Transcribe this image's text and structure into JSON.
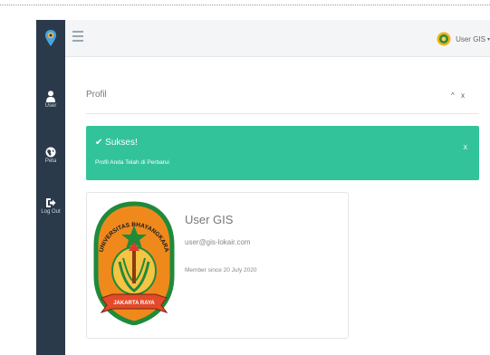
{
  "sidebar": {
    "items": [
      {
        "label": "User",
        "icon": "user-icon"
      },
      {
        "label": "Peta",
        "icon": "globe-icon"
      },
      {
        "label": "Log Out",
        "icon": "logout-icon"
      }
    ]
  },
  "topbar": {
    "user_name": "User GIS",
    "caret": "▾"
  },
  "panel": {
    "title": "Profil",
    "collapse_icon": "^",
    "close_icon": "x"
  },
  "alert": {
    "title": "✔ Sukses!",
    "message": "Profil Anda Telah di Perbarui",
    "close": "x"
  },
  "profile": {
    "name": "User GIS",
    "email": "user@gis-lokair.com",
    "member_since": "Member since 20 July 2020",
    "logo_arc_text": "UNIVERSITAS BHAYANGKARA",
    "logo_ribbon_text": "JAKARTA RAYA"
  },
  "colors": {
    "sidebar": "#2b3a4a",
    "alert": "#32c39a",
    "logo_orange": "#f0891c",
    "logo_green": "#1f8a3a"
  }
}
